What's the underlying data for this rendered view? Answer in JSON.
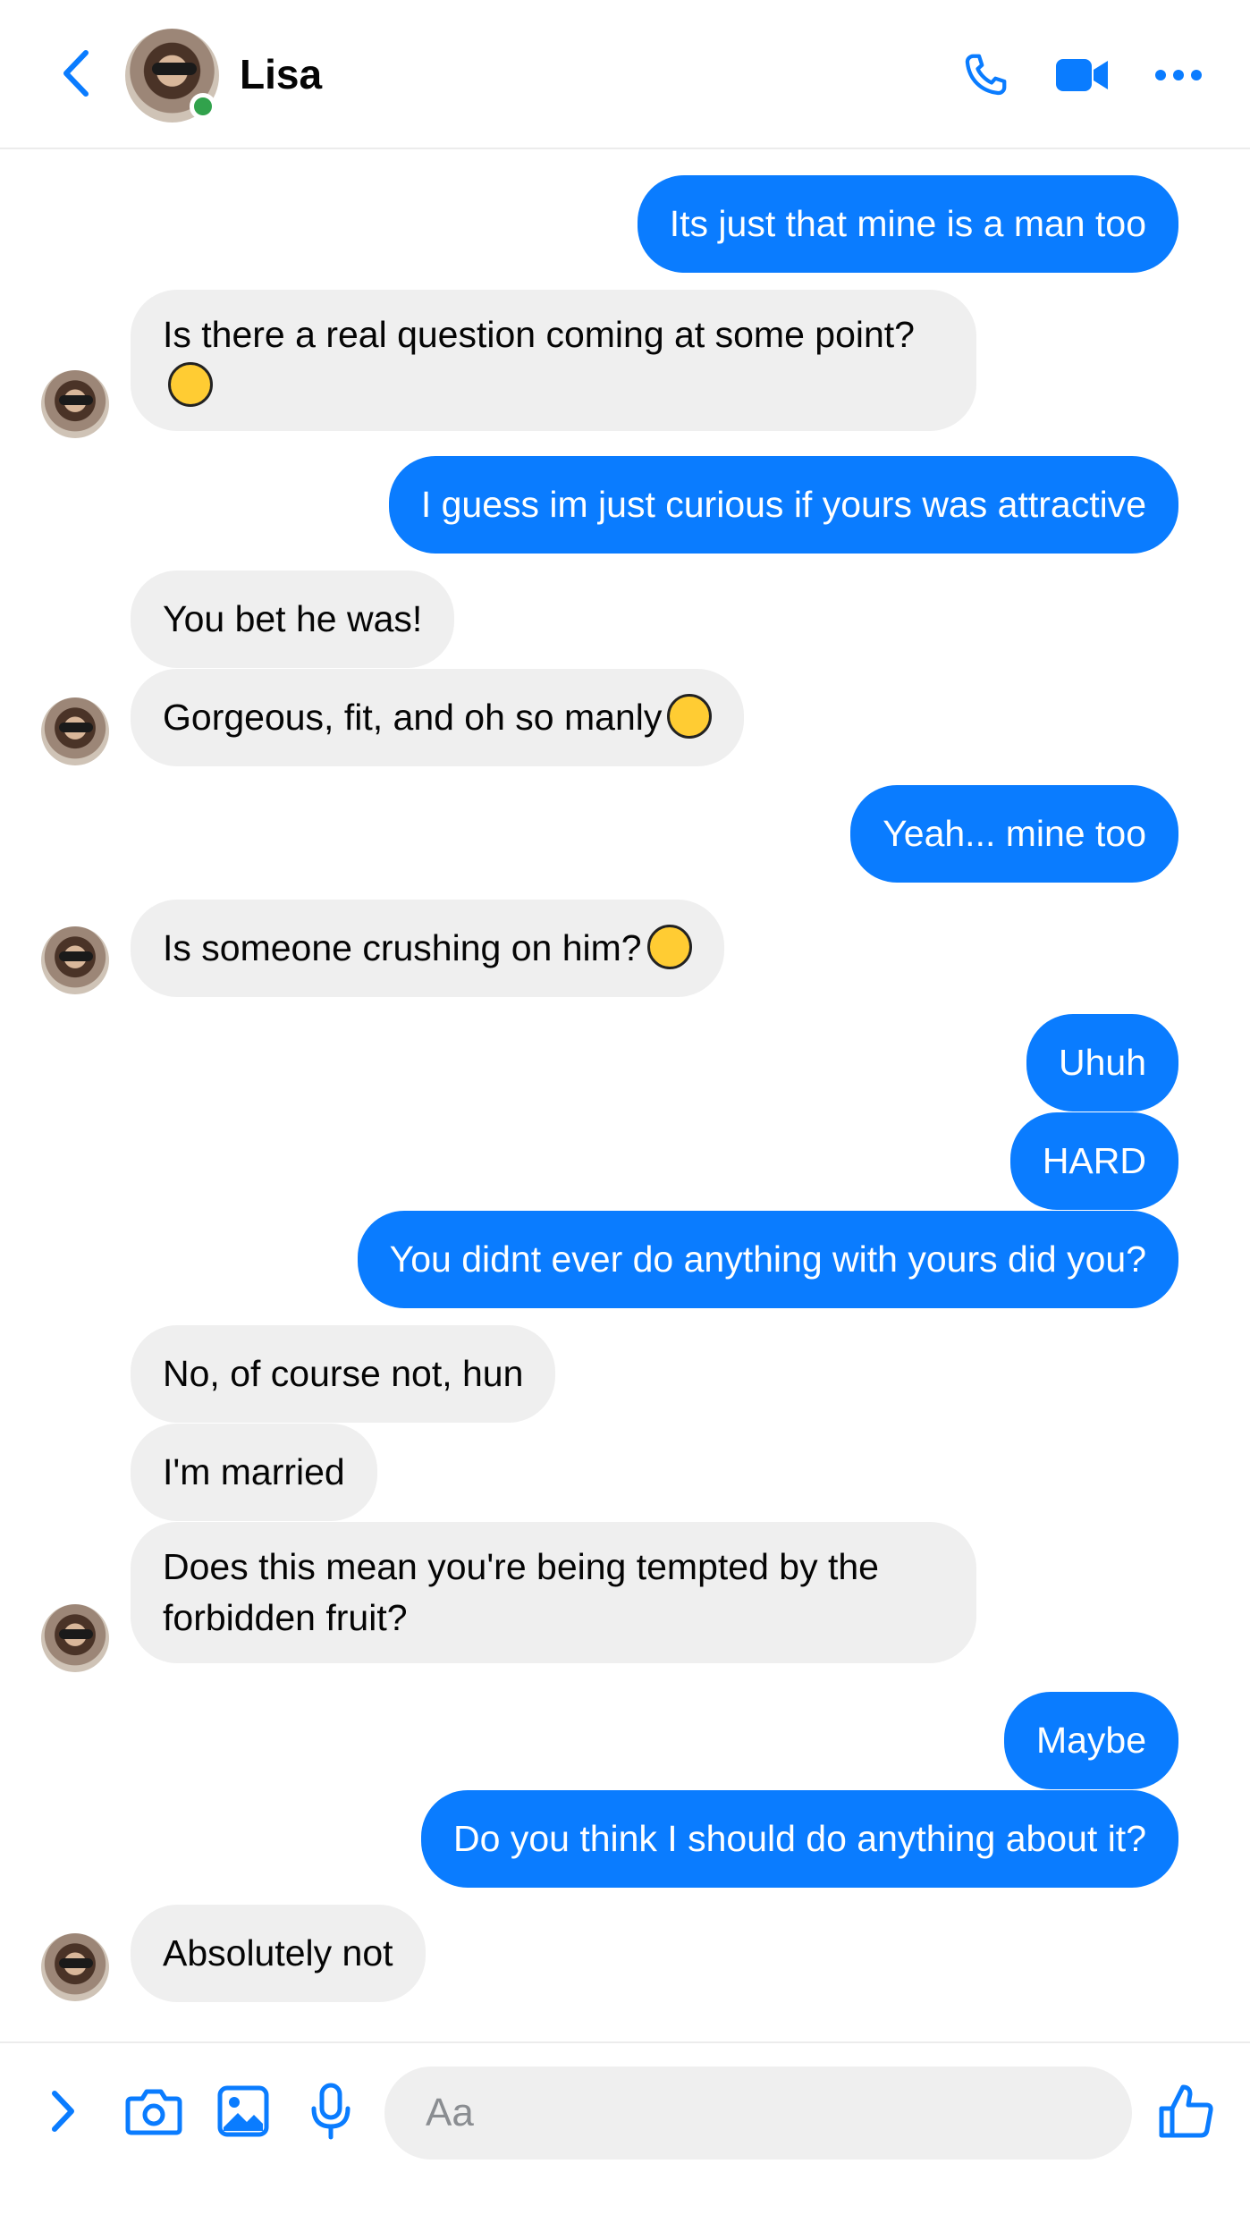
{
  "header": {
    "contact_name": "Lisa",
    "back_icon": "chevron-left-icon",
    "call_icon": "phone-icon",
    "video_icon": "video-camera-icon",
    "more_icon": "more-horizontal-icon",
    "online": true
  },
  "colors": {
    "accent": "#0a7cff",
    "incoming_bubble": "#efefef",
    "online": "#31a24c"
  },
  "messages": [
    {
      "dir": "out",
      "text": "Its just that mine is a man too"
    },
    {
      "dir": "in",
      "text": "Is there a real question coming at some point?",
      "emoji": "grinning-face-emoji"
    },
    {
      "dir": "out",
      "text": "I guess im just curious if yours was attractive"
    },
    {
      "dir": "in",
      "text": "You bet he was!"
    },
    {
      "dir": "in",
      "text": "Gorgeous, fit, and oh so manly",
      "emoji": "face-savoring-food-emoji"
    },
    {
      "dir": "out",
      "text": "Yeah... mine too"
    },
    {
      "dir": "in",
      "text": "Is someone crushing on him?",
      "emoji": "face-with-hand-over-mouth-emoji"
    },
    {
      "dir": "out",
      "text": "Uhuh"
    },
    {
      "dir": "out",
      "text": "HARD"
    },
    {
      "dir": "out",
      "text": "You didnt ever do anything with yours did you?"
    },
    {
      "dir": "in",
      "text": "No, of course not, hun"
    },
    {
      "dir": "in",
      "text": "I'm married"
    },
    {
      "dir": "in",
      "text": "Does this mean you're being tempted by the forbidden fruit?"
    },
    {
      "dir": "out",
      "text": "Maybe"
    },
    {
      "dir": "out",
      "text": "Do you think I should do anything about it?"
    },
    {
      "dir": "in",
      "text": "Absolutely not"
    }
  ],
  "composer": {
    "placeholder": "Aa",
    "value": "",
    "expand_icon": "chevron-right-icon",
    "camera_icon": "camera-icon",
    "gallery_icon": "image-icon",
    "mic_icon": "microphone-icon",
    "like_icon": "thumbs-up-icon"
  }
}
